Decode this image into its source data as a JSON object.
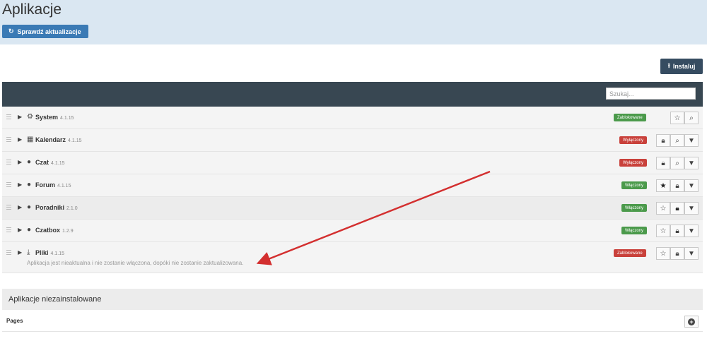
{
  "page": {
    "title": "Aplikacje",
    "check_updates_label": "Sprawdź aktualizacje",
    "install_label": "Instaluj",
    "search_placeholder": "Szukaj..."
  },
  "apps": [
    {
      "name": "System",
      "version": "4.1.15",
      "icon": "gears-icon",
      "status": "Zablokowane",
      "status_color": "#4b9a4b"
    },
    {
      "name": "Kalendarz",
      "version": "4.1.15",
      "icon": "calendar-icon",
      "status": "Wyłączony",
      "status_color": "#c9413b"
    },
    {
      "name": "Czat",
      "version": "4.1.15",
      "icon": "comment-icon",
      "status": "Wyłączony",
      "status_color": "#c9413b"
    },
    {
      "name": "Forum",
      "version": "4.1.15",
      "icon": "comments-icon",
      "status": "Włączony",
      "status_color": "#4b9a4b"
    },
    {
      "name": "Poradniki",
      "version": "2.1.0",
      "icon": "comments-icon",
      "status": "Włączony",
      "status_color": "#4b9a4b"
    },
    {
      "name": "Czatbox",
      "version": "1.2.9",
      "icon": "comments-icon",
      "status": "Włączony",
      "status_color": "#4b9a4b"
    },
    {
      "name": "Pliki",
      "version": "4.1.15",
      "icon": "download-icon",
      "status": "Zablokowane",
      "status_color": "#c9413b",
      "message": "Aplikacja jest nieaktualna i nie zostanie włączona, dopóki nie zostanie zaktualizowana."
    }
  ],
  "uninstalled": {
    "title": "Aplikacje niezainstalowane",
    "items": [
      {
        "name": "Pages"
      }
    ]
  },
  "colors": {
    "header_bg": "#dae7f2",
    "primary": "#3a7ab5",
    "dark": "#364c61",
    "toolbar": "#384752",
    "annotation": "#d32f2f"
  }
}
